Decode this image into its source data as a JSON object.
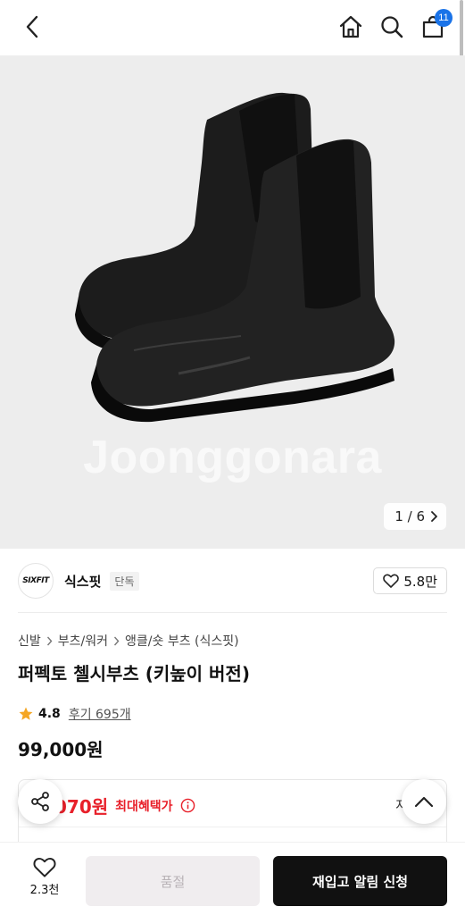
{
  "header": {
    "back_icon": "chevron-left-icon",
    "home_icon": "home-icon",
    "search_icon": "search-icon",
    "cart_icon": "shopping-bag-icon",
    "cart_count": "11"
  },
  "gallery": {
    "watermark": "Joonggonara",
    "current": "1",
    "total": "6",
    "counter_text": "1 / 6"
  },
  "brand": {
    "logo_text": "SIXFIT",
    "name": "식스핏",
    "tag": "단독",
    "likes": "5.8만"
  },
  "breadcrumb": [
    "신발",
    "부츠/워커",
    "앵클/숏 부츠 (식스핏)"
  ],
  "product": {
    "title": "퍼펙토 첼시부츠 (키높이 버전)",
    "rating": "4.8",
    "reviews": "후기 695개",
    "price": "99,000원"
  },
  "benefit": {
    "price_partial": "070원",
    "label": "최대혜택가",
    "detail_partial": "자세히"
  },
  "bottom": {
    "wish_count": "2.3천",
    "soldout_label": "품절",
    "restock_label": "재입고 알림 신청"
  },
  "colors": {
    "accent_red": "#e8202a",
    "badge_blue": "#1a73e8",
    "star": "#f5a623",
    "primary_button": "#111111"
  }
}
